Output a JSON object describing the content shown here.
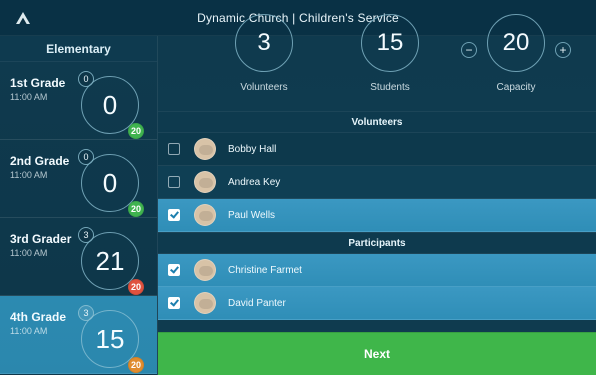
{
  "app": {
    "title": "Dynamic Church | Children's Service"
  },
  "left": {
    "header": "Elementary",
    "grades": [
      {
        "name": "1st Grade",
        "time": "11:00 AM",
        "mini": "0",
        "count": "0",
        "badge": "20",
        "badge_color": "#3fb34f",
        "active": false
      },
      {
        "name": "2nd Grade",
        "time": "11:00 AM",
        "mini": "0",
        "count": "0",
        "badge": "20",
        "badge_color": "#3fb34f",
        "active": false
      },
      {
        "name": "3rd Grader",
        "time": "11:00 AM",
        "mini": "3",
        "count": "21",
        "badge": "20",
        "badge_color": "#e0523f",
        "active": false
      },
      {
        "name": "4th Grade",
        "time": "11:00 AM",
        "mini": "3",
        "count": "15",
        "badge": "20",
        "badge_color": "#e08c2e",
        "active": true
      }
    ]
  },
  "stats": {
    "volunteers": {
      "value": "3",
      "label": "Volunteers"
    },
    "students": {
      "value": "15",
      "label": "Students"
    },
    "capacity": {
      "value": "20",
      "label": "Capacity",
      "minus": "−",
      "plus": "+"
    }
  },
  "sections": {
    "volunteers": {
      "title": "Volunteers",
      "people": [
        {
          "name": "Bobby Hall",
          "checked": false
        },
        {
          "name": "Andrea Key",
          "checked": false
        },
        {
          "name": "Paul Wells",
          "checked": true
        }
      ]
    },
    "participants": {
      "title": "Participants",
      "people": [
        {
          "name": "Christine Farmet",
          "checked": true
        },
        {
          "name": "David Panter",
          "checked": true
        }
      ]
    }
  },
  "next": {
    "label": "Next"
  }
}
